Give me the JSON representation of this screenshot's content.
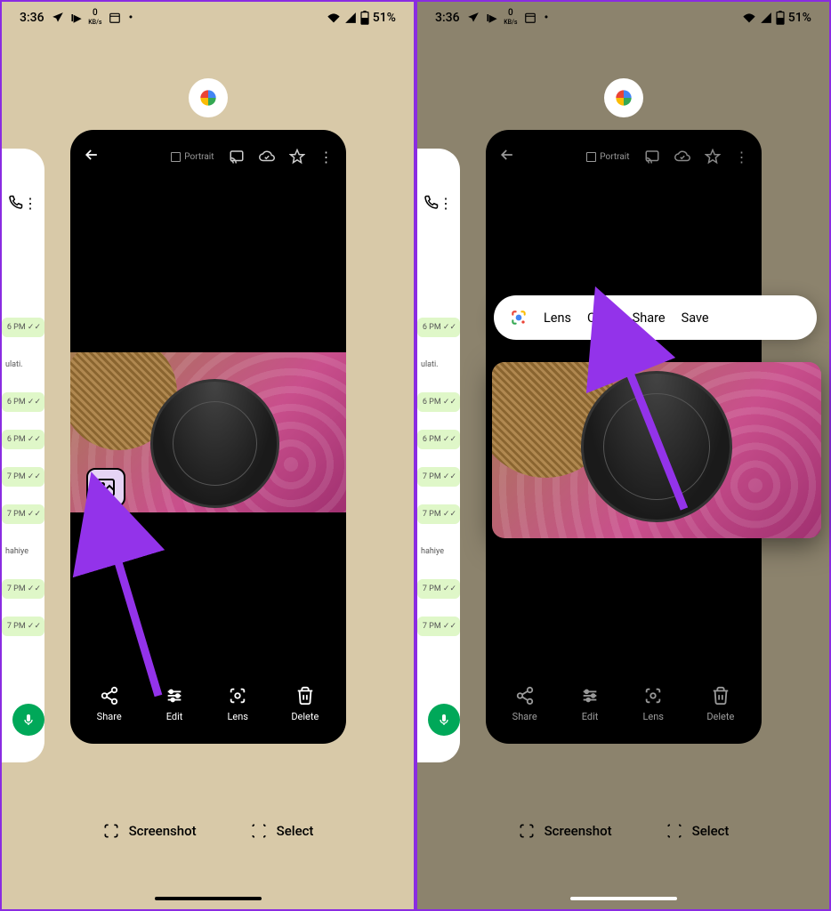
{
  "status": {
    "time": "3:36",
    "kbps": "0",
    "kbps_label": "KB/s",
    "battery": "51%"
  },
  "viewer": {
    "badge": "Portrait",
    "actions": {
      "share": "Share",
      "edit": "Edit",
      "lens": "Lens",
      "delete": "Delete"
    }
  },
  "recents": {
    "screenshot": "Screenshot",
    "select": "Select"
  },
  "context": {
    "lens": "Lens",
    "copy": "Copy",
    "share": "Share",
    "save": "Save"
  },
  "peek": {
    "msgs": [
      "6 PM ✓✓",
      "ulati.",
      "6 PM ✓✓",
      "6 PM ✓✓",
      "7 PM ✓✓",
      "7 PM ✓✓",
      "hahiye",
      "7 PM ✓✓",
      "7 PM ✓✓"
    ]
  }
}
